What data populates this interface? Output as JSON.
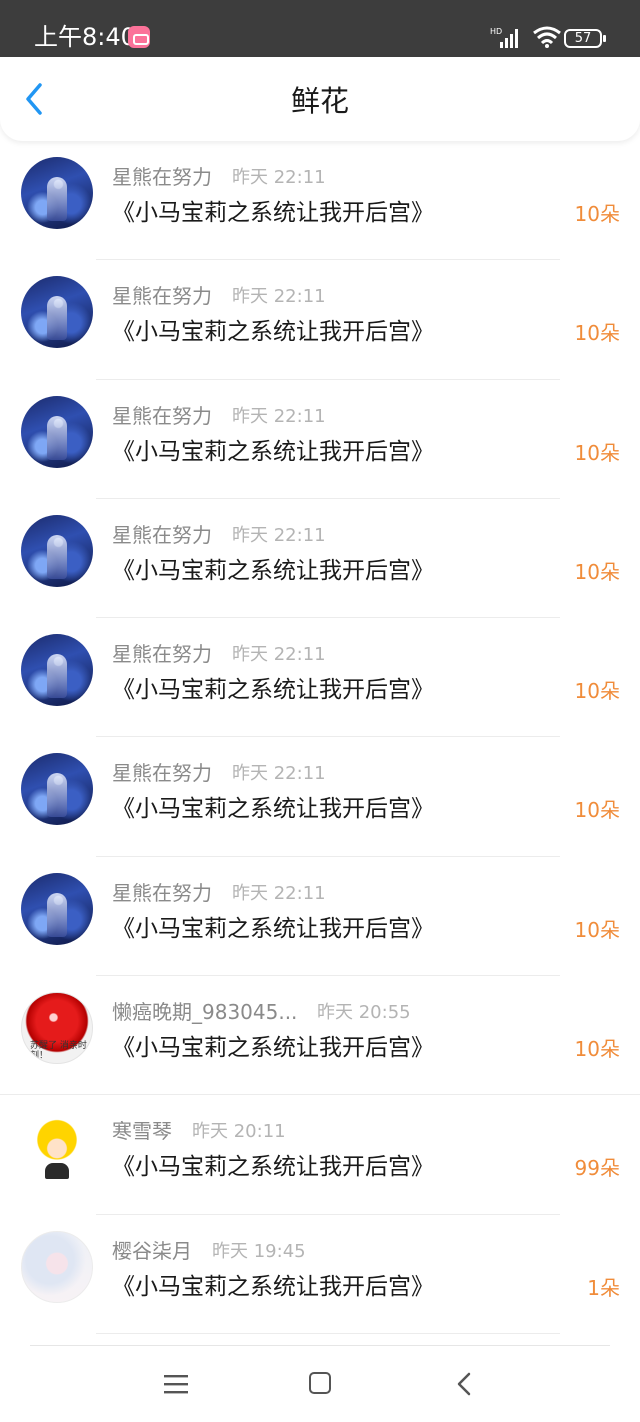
{
  "status": {
    "time": "上午8:40",
    "battery": "57",
    "network": "HD"
  },
  "header": {
    "title": "鲜花"
  },
  "rows": [
    {
      "user": "星熊在努力",
      "time": "昨天 22:11",
      "book": "《小马宝莉之系统让我开后宫》",
      "count": "10朵",
      "avatar": "night"
    },
    {
      "user": "星熊在努力",
      "time": "昨天 22:11",
      "book": "《小马宝莉之系统让我开后宫》",
      "count": "10朵",
      "avatar": "night"
    },
    {
      "user": "星熊在努力",
      "time": "昨天 22:11",
      "book": "《小马宝莉之系统让我开后宫》",
      "count": "10朵",
      "avatar": "night"
    },
    {
      "user": "星熊在努力",
      "time": "昨天 22:11",
      "book": "《小马宝莉之系统让我开后宫》",
      "count": "10朵",
      "avatar": "night"
    },
    {
      "user": "星熊在努力",
      "time": "昨天 22:11",
      "book": "《小马宝莉之系统让我开后宫》",
      "count": "10朵",
      "avatar": "night"
    },
    {
      "user": "星熊在努力",
      "time": "昨天 22:11",
      "book": "《小马宝莉之系统让我开后宫》",
      "count": "10朵",
      "avatar": "night"
    },
    {
      "user": "星熊在努力",
      "time": "昨天 22:11",
      "book": "《小马宝莉之系统让我开后宫》",
      "count": "10朵",
      "avatar": "night"
    },
    {
      "user": "懒癌晚期_983045...",
      "time": "昨天 20:55",
      "book": "《小马宝莉之系统让我开后宫》",
      "count": "10朵",
      "avatar": "red",
      "avatar_caption": "苏醒了 消亲时刻！"
    },
    {
      "user": "寒雪琴",
      "time": "昨天 20:11",
      "book": "《小马宝莉之系统让我开后宫》",
      "count": "99朵",
      "avatar": "blonde"
    },
    {
      "user": "樱谷柒月",
      "time": "昨天 19:45",
      "book": "《小马宝莉之系统让我开后宫》",
      "count": "1朵",
      "avatar": "pale"
    }
  ],
  "colors": {
    "accent_blue": "#2196f3",
    "count_orange": "#f08c3a",
    "status_bar": "#3d3d3d"
  },
  "icons": {
    "back": "chevron-left-icon",
    "nav_menu": "menu-icon",
    "nav_home": "home-square-icon",
    "nav_back": "nav-back-icon"
  }
}
